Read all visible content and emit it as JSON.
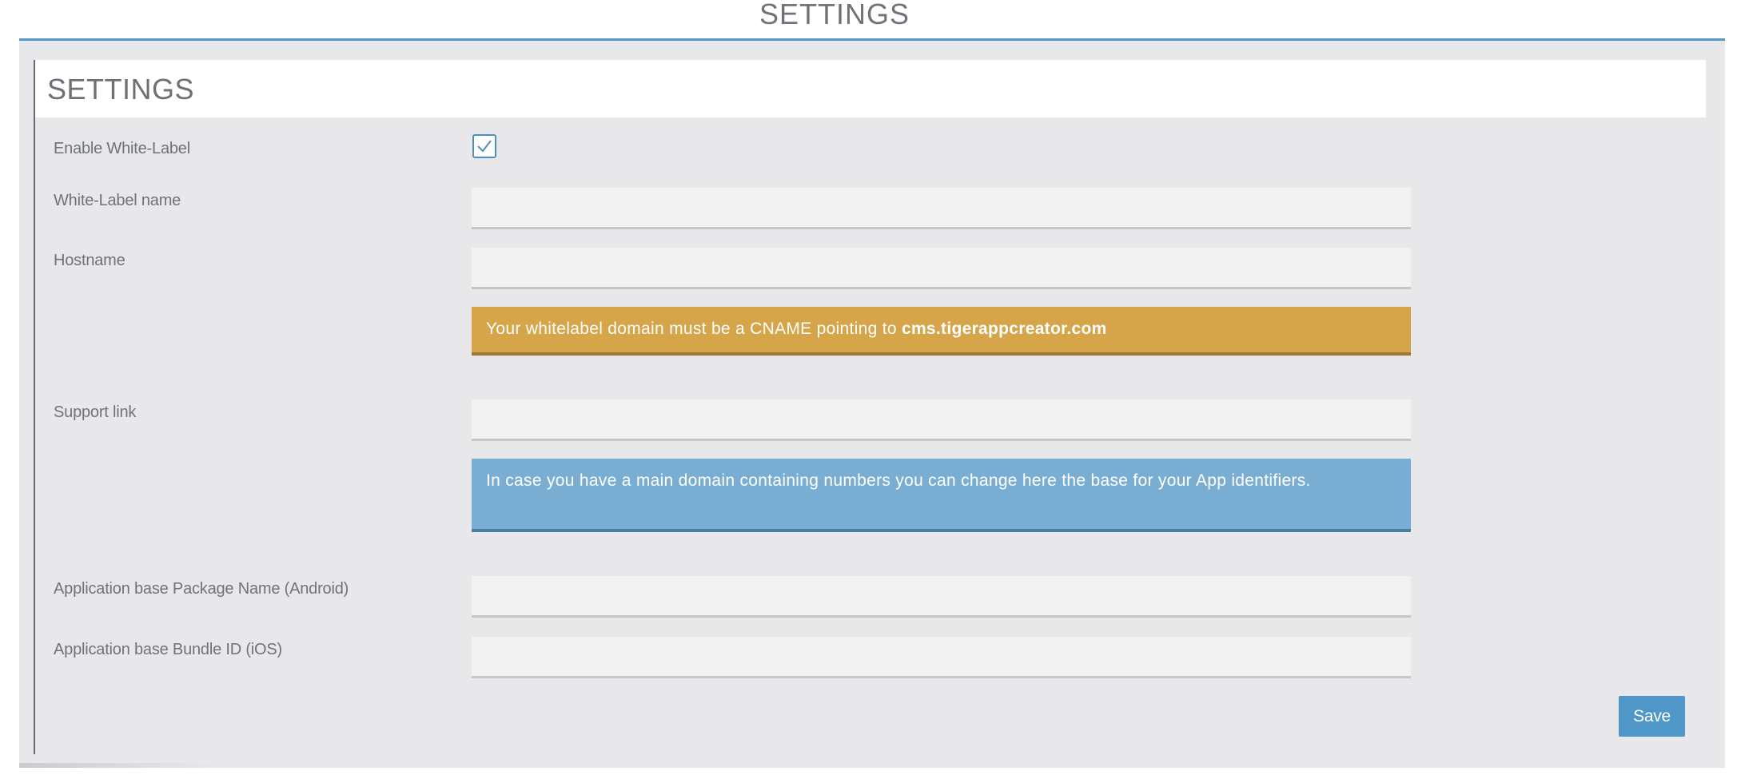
{
  "header": {
    "title": "SETTINGS"
  },
  "panel": {
    "title": "SETTINGS",
    "fields": {
      "enable_white_label": {
        "label": "Enable White-Label",
        "checked": true
      },
      "white_label_name": {
        "label": "White-Label name",
        "value": "",
        "placeholder": ""
      },
      "hostname": {
        "label": "Hostname",
        "value": "",
        "placeholder": ""
      },
      "support_link": {
        "label": "Support link",
        "value": "",
        "placeholder": ""
      },
      "android_package": {
        "label": "Application base Package Name (Android)",
        "value": "",
        "placeholder": ""
      },
      "ios_bundle": {
        "label": "Application base Bundle ID (iOS)",
        "value": "",
        "placeholder": ""
      }
    },
    "alerts": {
      "cname_warning": {
        "text": "Your whitelabel domain must be a CNAME pointing to ",
        "domain": "cms.tigerappcreator.com"
      },
      "identifier_info": {
        "text": "In case you have a main domain containing numbers you can change here the base for your App identifiers."
      }
    },
    "save_label": "Save"
  },
  "icons": {
    "checkbox_check": "check-icon"
  },
  "colors": {
    "accent_blue": "#4f97c8",
    "header_rule": "#5499c7",
    "warning": "#d6a449",
    "info": "#79aed2",
    "panel_bg": "#e8e8ea"
  }
}
